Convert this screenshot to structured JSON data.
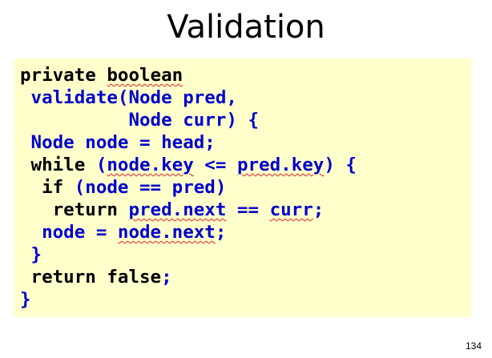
{
  "slide": {
    "title": "Validation",
    "page_number": "134"
  },
  "colors": {
    "code_background": "#ffffcc",
    "keyword_black": "#000000",
    "code_blue": "#0000cc",
    "spellcheck_squiggle": "#e02020"
  },
  "code": {
    "lines": [
      {
        "tokens": [
          {
            "text": "private ",
            "color": "black"
          },
          {
            "text": "boolean",
            "color": "black",
            "squiggle": true
          }
        ]
      },
      {
        "tokens": [
          {
            "text": " validate(Node pred,",
            "color": "blue"
          }
        ]
      },
      {
        "tokens": [
          {
            "text": "          Node curr) {",
            "color": "blue"
          }
        ]
      },
      {
        "tokens": [
          {
            "text": " Node node = head;",
            "color": "blue"
          }
        ]
      },
      {
        "tokens": [
          {
            "text": " while ",
            "color": "black"
          },
          {
            "text": "(",
            "color": "blue"
          },
          {
            "text": "node.key",
            "color": "blue",
            "squiggle": true
          },
          {
            "text": " <= ",
            "color": "blue"
          },
          {
            "text": "pred.key",
            "color": "blue",
            "squiggle": true
          },
          {
            "text": ") {",
            "color": "blue"
          }
        ]
      },
      {
        "tokens": [
          {
            "text": "  if ",
            "color": "black"
          },
          {
            "text": "(node == pred)",
            "color": "blue"
          }
        ]
      },
      {
        "tokens": [
          {
            "text": "   return ",
            "color": "black"
          },
          {
            "text": "pred.next",
            "color": "blue",
            "squiggle": true
          },
          {
            "text": " == ",
            "color": "blue"
          },
          {
            "text": "curr",
            "color": "blue",
            "squiggle": true
          },
          {
            "text": ";",
            "color": "blue"
          }
        ]
      },
      {
        "tokens": [
          {
            "text": "  node = ",
            "color": "blue"
          },
          {
            "text": "node.next",
            "color": "blue",
            "squiggle": true
          },
          {
            "text": ";",
            "color": "blue"
          }
        ]
      },
      {
        "tokens": [
          {
            "text": " }",
            "color": "blue"
          }
        ]
      },
      {
        "tokens": [
          {
            "text": " return false",
            "color": "black"
          },
          {
            "text": ";",
            "color": "blue"
          }
        ]
      },
      {
        "tokens": [
          {
            "text": "}",
            "color": "blue"
          }
        ]
      }
    ]
  }
}
